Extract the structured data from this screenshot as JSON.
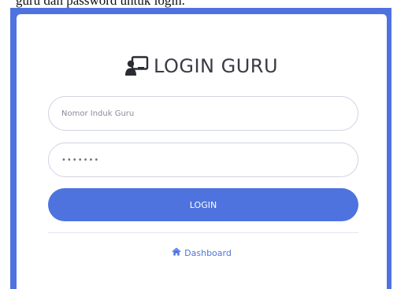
{
  "caption": "guru dan password untuk login.",
  "login": {
    "title": "LOGIN GURU",
    "title_icon": "chalkboard-teacher-icon",
    "nig_placeholder": "Nomor Induk Guru",
    "password_value": "•••••••",
    "submit_label": "LOGIN",
    "dashboard_label": "Dashboard",
    "dashboard_icon": "home-icon"
  },
  "colors": {
    "primary": "#4e73df",
    "text": "#3a3b45",
    "border": "#d1d3e2"
  }
}
